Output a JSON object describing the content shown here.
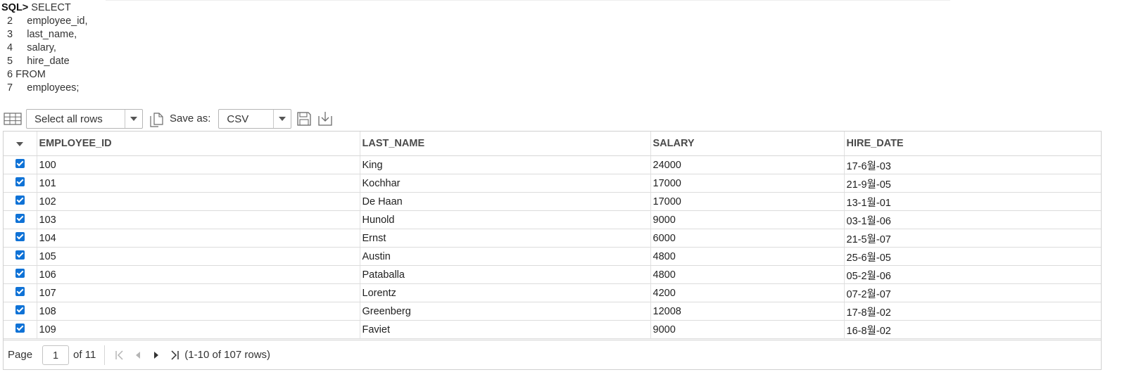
{
  "sql": {
    "prompt": "SQL>",
    "first_line": " SELECT",
    "lines": [
      {
        "num": "  2",
        "code": "     employee_id,"
      },
      {
        "num": "  3",
        "code": "     last_name,"
      },
      {
        "num": "  4",
        "code": "     salary,"
      },
      {
        "num": "  5",
        "code": "     hire_date"
      },
      {
        "num": "  6",
        "code": " FROM"
      },
      {
        "num": "  7",
        "code": "     employees;"
      }
    ]
  },
  "toolbar": {
    "grid_icon": "table-grid-icon",
    "select_rows": "Select all rows",
    "copy_icon": "copy-icon",
    "save_as_label": "Save as:",
    "format": "CSV",
    "save_icon": "save-disk-icon",
    "download_icon": "download-icon"
  },
  "table": {
    "columns": [
      "EMPLOYEE_ID",
      "LAST_NAME",
      "SALARY",
      "HIRE_DATE"
    ],
    "rows": [
      [
        "100",
        "King",
        "24000",
        "17-6월-03"
      ],
      [
        "101",
        "Kochhar",
        "17000",
        "21-9월-05"
      ],
      [
        "102",
        "De Haan",
        "17000",
        "13-1월-01"
      ],
      [
        "103",
        "Hunold",
        "9000",
        "03-1월-06"
      ],
      [
        "104",
        "Ernst",
        "6000",
        "21-5월-07"
      ],
      [
        "105",
        "Austin",
        "4800",
        "25-6월-05"
      ],
      [
        "106",
        "Pataballa",
        "4800",
        "05-2월-06"
      ],
      [
        "107",
        "Lorentz",
        "4200",
        "07-2월-07"
      ],
      [
        "108",
        "Greenberg",
        "12008",
        "17-8월-02"
      ],
      [
        "109",
        "Faviet",
        "9000",
        "16-8월-02"
      ]
    ],
    "checked": true
  },
  "pager": {
    "page_label": "Page",
    "page_value": "1",
    "of_label": "of 11",
    "summary": "(1-10 of 107 rows)"
  },
  "colors": {
    "checkbox": "#0f72d6",
    "border": "#d0d0d0",
    "icon": "#6b6b6b"
  }
}
